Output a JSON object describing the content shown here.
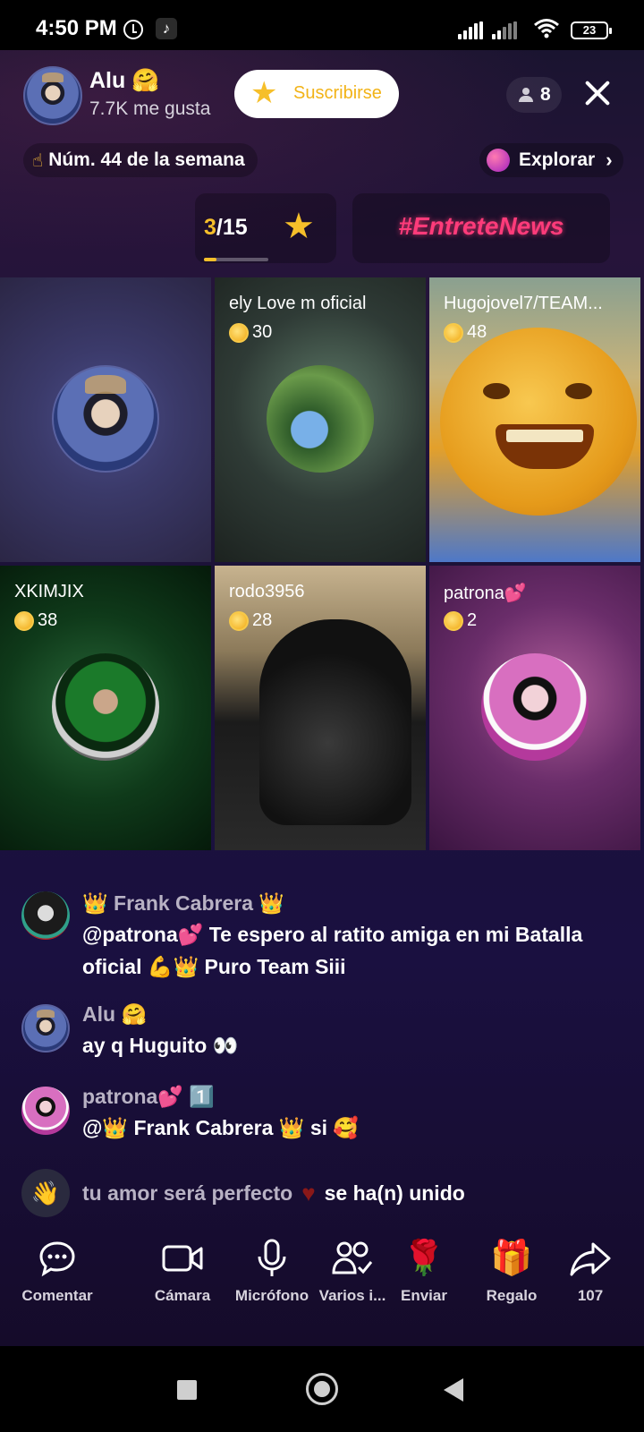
{
  "status_bar": {
    "time": "4:50 PM",
    "battery": "23",
    "icons": [
      "alarm-icon",
      "tiktok-icon",
      "signal-icon",
      "signal-icon",
      "wifi-icon",
      "battery-icon"
    ]
  },
  "header": {
    "host_name": "Alu 🤗",
    "host_likes": "7.7K me gusta",
    "subscribe_label": "Suscribirse",
    "viewer_count": "8",
    "rank_text": "Núm. 44 de la semana",
    "explore_label": "Explorar"
  },
  "goal": {
    "current": "3",
    "total": "/15",
    "progress": 0.2,
    "hashtag": "#EntreteNews"
  },
  "guests": [
    {
      "name": "",
      "coins": ""
    },
    {
      "name": "ely Love m oficial",
      "coins": "30"
    },
    {
      "name": "Hugojovel7/TEAM...",
      "coins": "48"
    },
    {
      "name": "XKIMJIX",
      "coins": "38"
    },
    {
      "name": "rodo3956",
      "coins": "28"
    },
    {
      "name": "patrona💕",
      "coins": "2"
    }
  ],
  "chat": [
    {
      "user": "👑 Frank Cabrera 👑",
      "text": "@patrona💕 Te espero al ratito amiga en mi Batalla oficial 💪👑 Puro Team Siii"
    },
    {
      "user": "Alu 🤗",
      "text": "ay q Huguito 👀"
    },
    {
      "user": "patrona💕 1️⃣",
      "text": "@👑 Frank Cabrera 👑 si 🥰"
    }
  ],
  "join_notice": {
    "user": "tu amor será perfecto",
    "action": "se ha(n) unido"
  },
  "toolbar": {
    "comment": "Comentar",
    "camera": "Cámara",
    "mic": "Micrófono",
    "multi": "Varios i...",
    "send": "Enviar",
    "gift": "Regalo",
    "share_count": "107"
  },
  "colors": {
    "accent_gold": "#f6bf2a",
    "hashtag_pink": "#ff3b7a"
  }
}
